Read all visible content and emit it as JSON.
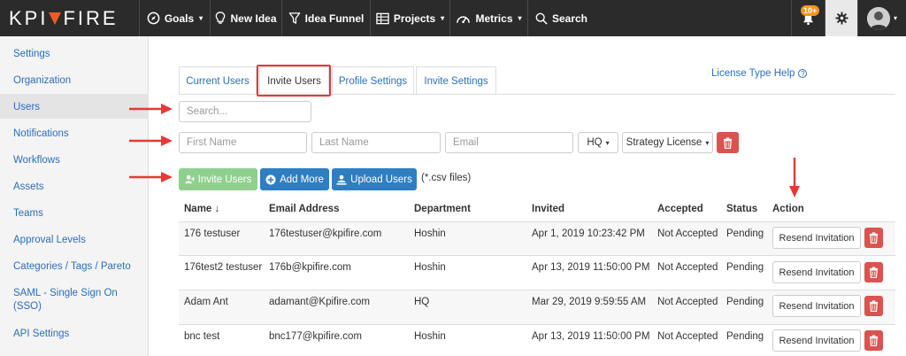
{
  "header": {
    "logo_left": "KPI",
    "logo_right": "FIRE",
    "nav": [
      {
        "label": "Goals",
        "icon": "compass-icon",
        "dropdown": true
      },
      {
        "label": "New Idea",
        "icon": "lightbulb-icon",
        "dropdown": false
      },
      {
        "label": "Idea Funnel",
        "icon": "funnel-icon",
        "dropdown": false
      },
      {
        "label": "Projects",
        "icon": "projects-icon",
        "dropdown": true
      },
      {
        "label": "Metrics",
        "icon": "speedometer-icon",
        "dropdown": true
      },
      {
        "label": "Search",
        "icon": "search-icon",
        "dropdown": false
      }
    ],
    "notification_count": "10+",
    "caret": "▾"
  },
  "sidebar": {
    "items": [
      {
        "label": "Settings"
      },
      {
        "label": "Organization"
      },
      {
        "label": "Users",
        "active": true
      },
      {
        "label": "Notifications"
      },
      {
        "label": "Workflows"
      },
      {
        "label": "Assets"
      },
      {
        "label": "Teams"
      },
      {
        "label": "Approval Levels"
      },
      {
        "label": "Categories / Tags / Pareto"
      },
      {
        "label": "SAML - Single Sign On (SSO)"
      },
      {
        "label": "API Settings"
      }
    ]
  },
  "tabs": [
    {
      "label": "Current Users"
    },
    {
      "label": "Invite Users",
      "active": true
    },
    {
      "label": "Profile Settings"
    },
    {
      "label": "Invite Settings"
    }
  ],
  "license_help": "License Type Help",
  "search": {
    "placeholder": "Search..."
  },
  "invite_form": {
    "first_name_placeholder": "First Name",
    "last_name_placeholder": "Last Name",
    "email_placeholder": "Email",
    "department": "HQ",
    "license": "Strategy License"
  },
  "actions": {
    "invite": "Invite Users",
    "add_more": "Add More",
    "upload": "Upload Users",
    "csv_note": "(*.csv files)"
  },
  "table": {
    "columns": [
      "Name ↓",
      "Email Address",
      "Department",
      "Invited",
      "Accepted",
      "Status",
      "Action"
    ],
    "rows": [
      {
        "name": "176 testuser",
        "email": "176testuser@kpifire.com",
        "department": "Hoshin",
        "invited": "Apr 1, 2019 10:23:42 PM",
        "accepted": "Not Accepted",
        "status": "Pending",
        "action": "Resend Invitation"
      },
      {
        "name": "176test2 testuser",
        "email": "176b@kpifire.com",
        "department": "Hoshin",
        "invited": "Apr 13, 2019 11:50:00 PM",
        "accepted": "Not Accepted",
        "status": "Pending",
        "action": "Resend Invitation"
      },
      {
        "name": "Adam Ant",
        "email": "adamant@Kpifire.com",
        "department": "HQ",
        "invited": "Mar 29, 2019 9:59:55 AM",
        "accepted": "Not Accepted",
        "status": "Pending",
        "action": "Resend Invitation"
      },
      {
        "name": "bnc test",
        "email": "bnc177@kpifire.com",
        "department": "Hoshin",
        "invited": "Apr 13, 2019 11:50:00 PM",
        "accepted": "Not Accepted",
        "status": "Pending",
        "action": "Resend Invitation"
      }
    ]
  },
  "colors": {
    "topbar": "#2b2b2b",
    "link": "#2a6ebb",
    "annotation": "#e53935",
    "danger": "#d9534f",
    "primary": "#2f7ec1",
    "success_disabled": "#8fd08f"
  }
}
